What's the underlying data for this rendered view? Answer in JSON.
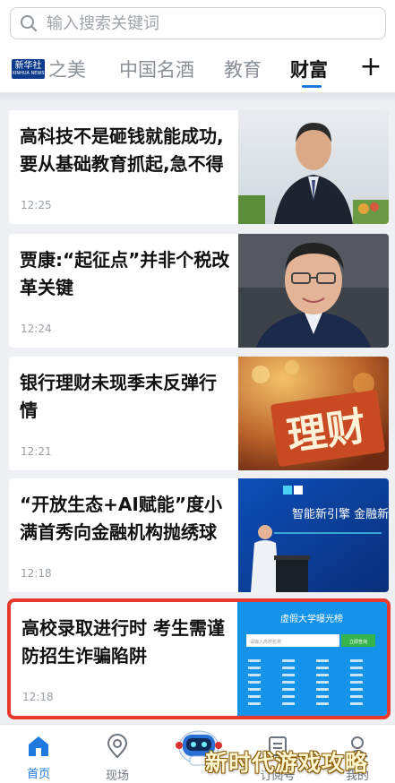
{
  "search": {
    "placeholder": "输入搜索关键词"
  },
  "logo": {
    "text": "新华社",
    "sub": "XINHUA NEWS"
  },
  "tabs": [
    {
      "label": "之美"
    },
    {
      "label": "中国名酒"
    },
    {
      "label": "教育"
    },
    {
      "label": "财富"
    }
  ],
  "tabs_add": "+",
  "articles": [
    {
      "title": "高科技不是砸钱就能成功,要从基础教育抓起,急不得",
      "time": "12:25"
    },
    {
      "title": "贾康:“起征点”并非个税改革关键",
      "time": "12:24"
    },
    {
      "title": "银行理财未现季末反弹行情",
      "time": "12:21",
      "image_text": "理财"
    },
    {
      "title": "“开放生态+AI赋能”度小满首秀向金融机构抛绣球",
      "time": "12:18",
      "image_text": "智能新引擎 金融新动力"
    },
    {
      "title": "高校录取进行时 考生需谨防招生诈骗陷阱",
      "time": "12:18",
      "image_text": "虚假大学曝光榜",
      "image_button": "立即查询",
      "image_input": "请输入高校名称"
    }
  ],
  "bottom_nav": [
    {
      "label": "首页"
    },
    {
      "label": "现场"
    },
    {
      "label": "订阅号"
    },
    {
      "label": "我的"
    }
  ],
  "watermark": "新时代游戏攻略",
  "colors": {
    "accent": "#1f7ae0",
    "highlight_border": "#e8392c"
  }
}
